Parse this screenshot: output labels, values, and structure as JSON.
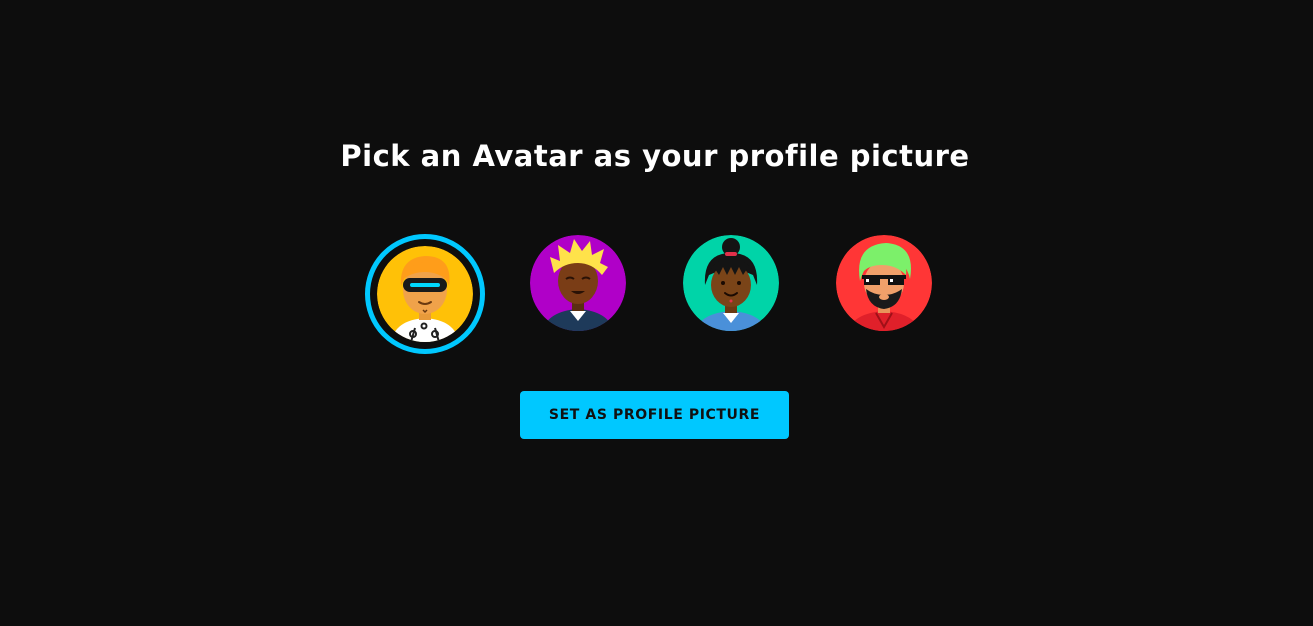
{
  "page": {
    "title": "Pick an Avatar as your profile picture"
  },
  "avatars": [
    {
      "id": "avatar-1",
      "description": "robot visor avatar",
      "background": "#ffc107",
      "selected": true
    },
    {
      "id": "avatar-2",
      "description": "spiky blonde hair avatar",
      "background": "#b000c8",
      "selected": false
    },
    {
      "id": "avatar-3",
      "description": "hair bun avatar",
      "background": "#00d4a8",
      "selected": false
    },
    {
      "id": "avatar-4",
      "description": "pixel sunglasses avatar",
      "background": "#ff3636",
      "selected": false
    }
  ],
  "actions": {
    "set_profile_label": "SET AS PROFILE PICTURE"
  },
  "colors": {
    "background": "#0d0d0d",
    "accent": "#00c8ff",
    "title_text": "#ffffff",
    "button_text": "#111111"
  }
}
